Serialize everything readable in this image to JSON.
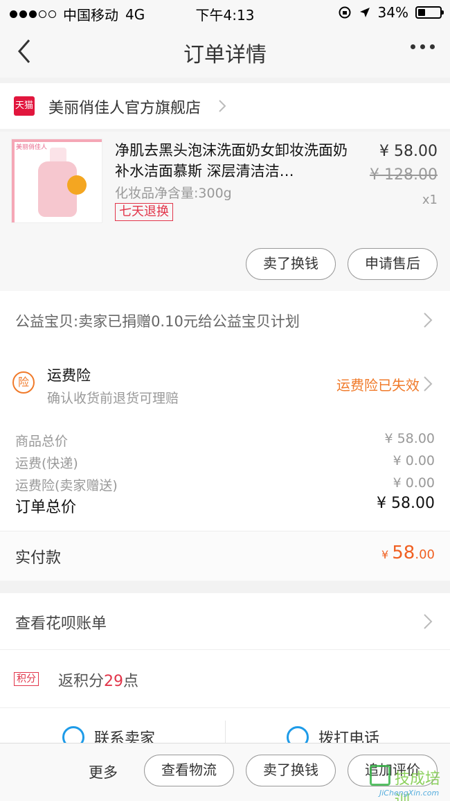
{
  "status_bar": {
    "carrier": "中国移动",
    "network": "4G",
    "time": "下午4:13",
    "battery": "34%",
    "battery_level": 0.34
  },
  "nav": {
    "title": "订单详情"
  },
  "shop": {
    "logo_text": "天猫",
    "name": "美丽俏佳人官方旗舰店"
  },
  "product": {
    "image_brand": "美丽俏佳人",
    "title": "净肌去黑头泡沫洗面奶女卸妆洗面奶 补水洁面慕斯 深层清洁洁…",
    "spec": "化妆品净含量:300g",
    "badge": "七天退换",
    "price": "¥ 58.00",
    "original_price": "¥ 128.00",
    "quantity": "x1",
    "sell_button": "卖了换钱",
    "aftersale_button": "申请售后"
  },
  "charity": {
    "text": "公益宝贝:卖家已捐赠0.10元给公益宝贝计划"
  },
  "insurance": {
    "icon_text": "险",
    "title": "运费险",
    "subtitle": "确认收货前退货可理赔",
    "status": "运费险已失效"
  },
  "summary": {
    "rows": [
      {
        "label": "商品总价",
        "value": "¥ 58.00"
      },
      {
        "label": "运费(快递)",
        "value": "¥ 0.00"
      },
      {
        "label": "运费险(卖家赠送)",
        "value": "¥ 0.00"
      }
    ],
    "total_label": "订单总价",
    "total_value": "¥ 58.00"
  },
  "paid": {
    "label": "实付款",
    "currency": "¥",
    "integer": "58",
    "decimal": ".00"
  },
  "huabei": {
    "text": "查看花呗账单"
  },
  "points": {
    "badge": "积分",
    "prefix": "返积分",
    "count": "29",
    "suffix": "点"
  },
  "contact": {
    "seller": "联系卖家",
    "phone": "拨打电话"
  },
  "bottom_bar": {
    "more": "更多",
    "logistics": "查看物流",
    "sell": "卖了换钱",
    "review": "追加评价"
  },
  "watermark": {
    "cn": "技成培训",
    "en": "JiChengXin.com"
  },
  "colors": {
    "accent_orange": "#f06022",
    "tmall_red": "#e1163d",
    "badge_red": "#e2354a",
    "insurance_orange": "#f07a2a"
  }
}
